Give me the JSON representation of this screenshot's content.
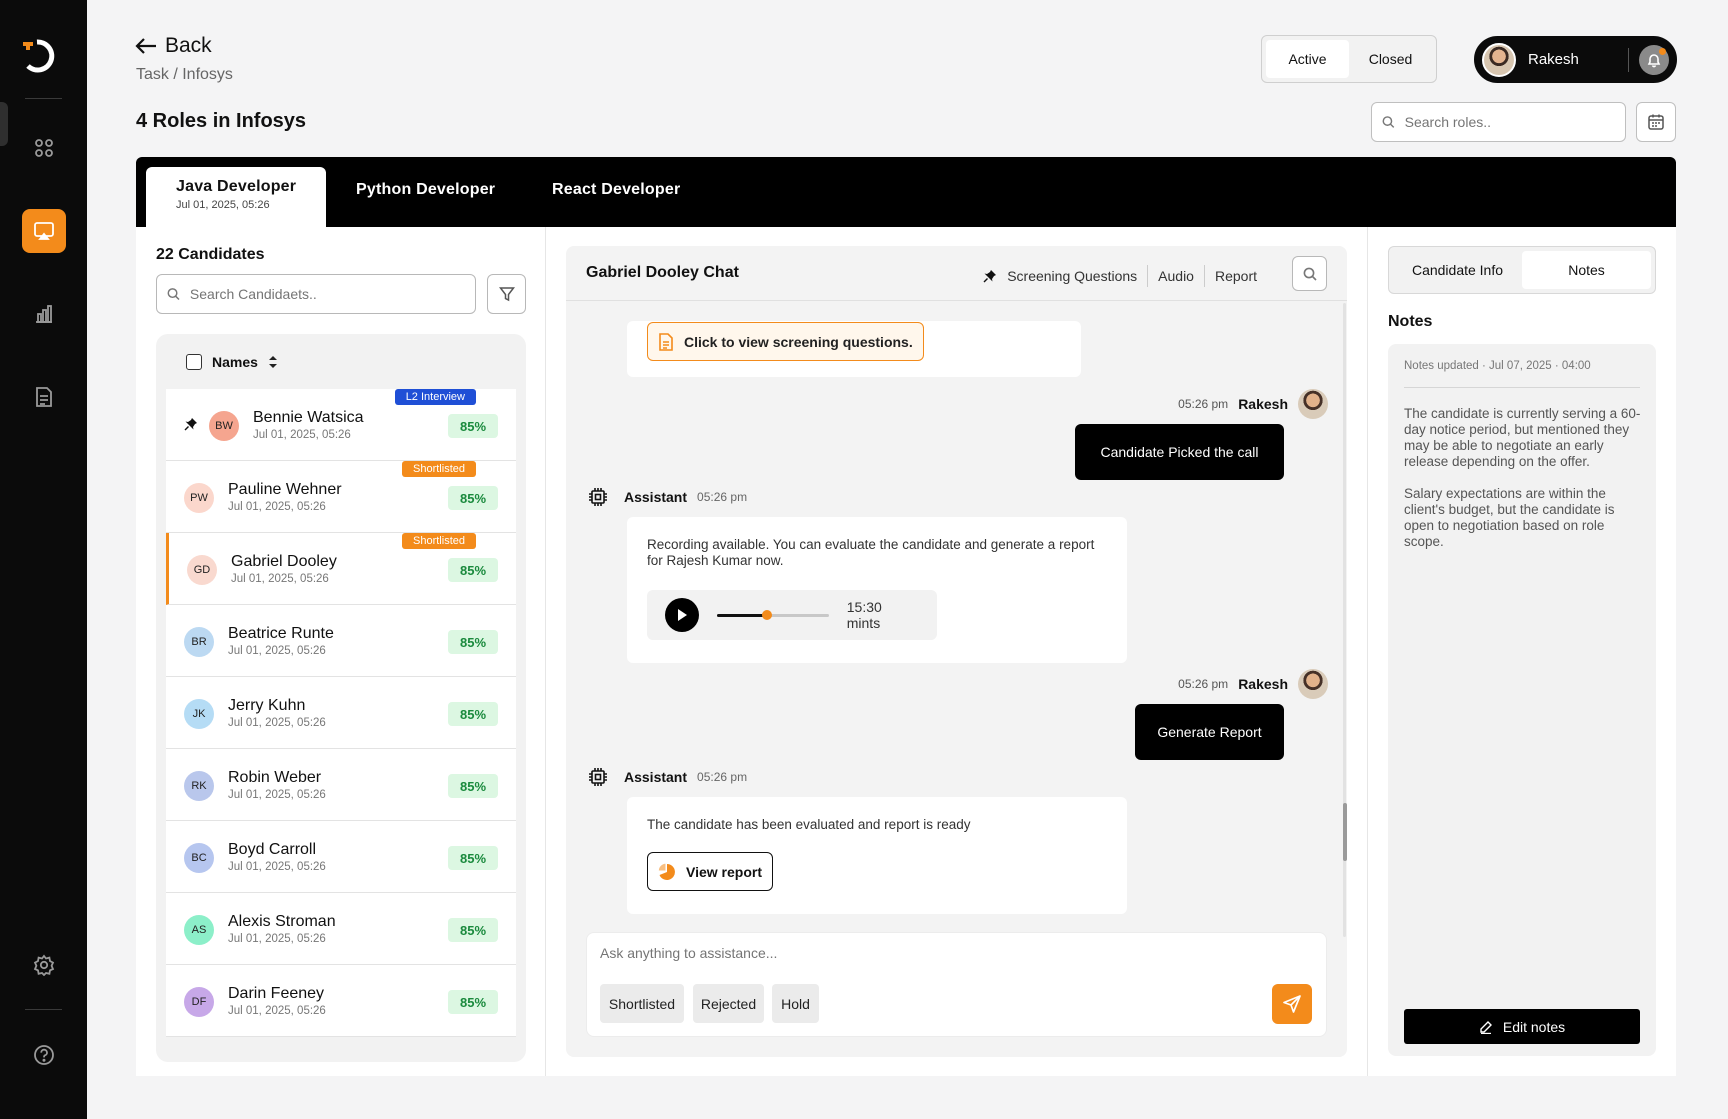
{
  "header": {
    "back_label": "Back",
    "breadcrumb": "Task / Infosys",
    "page_title": "4 Roles in Infosys",
    "status_toggle": {
      "active_label": "Active",
      "closed_label": "Closed",
      "selected": "Active"
    },
    "user": {
      "name": "Rakesh"
    },
    "search_roles_placeholder": "Search roles.."
  },
  "tabs": [
    {
      "label": "Java Developer",
      "date": "Jul 01, 2025, 05:26",
      "active": true
    },
    {
      "label": "Python Developer",
      "active": false
    },
    {
      "label": "React Developer",
      "active": false
    }
  ],
  "candidates_panel": {
    "count_label": "22 Candidates",
    "search_placeholder": "Search Candidaets..",
    "names_header": "Names",
    "candidates": [
      {
        "initials": "BW",
        "name": "Bennie Watsica",
        "date": "Jul 01, 2025, 05:26",
        "score": "85%",
        "badge": "L2 Interview",
        "pinned": true,
        "selected": false,
        "avatar_color": "#f5a58f"
      },
      {
        "initials": "PW",
        "name": "Pauline Wehner",
        "date": "Jul 01, 2025, 05:26",
        "score": "85%",
        "badge": "Shortlisted",
        "pinned": false,
        "selected": false,
        "avatar_color": "#fbd7cc"
      },
      {
        "initials": "GD",
        "name": "Gabriel Dooley",
        "date": "Jul 01, 2025, 05:26",
        "score": "85%",
        "badge": "Shortlisted",
        "pinned": false,
        "selected": true,
        "avatar_color": "#f9d9cf"
      },
      {
        "initials": "BR",
        "name": "Beatrice Runte",
        "date": "Jul 01, 2025, 05:26",
        "score": "85%",
        "badge": "",
        "pinned": false,
        "selected": false,
        "avatar_color": "#bcd9f2"
      },
      {
        "initials": "JK",
        "name": "Jerry Kuhn",
        "date": "Jul 01, 2025, 05:26",
        "score": "85%",
        "badge": "",
        "pinned": false,
        "selected": false,
        "avatar_color": "#b5dcf5"
      },
      {
        "initials": "RK",
        "name": "Robin Weber",
        "date": "Jul 01, 2025, 05:26",
        "score": "85%",
        "badge": "",
        "pinned": false,
        "selected": false,
        "avatar_color": "#b9c7ec"
      },
      {
        "initials": "BC",
        "name": "Boyd Carroll",
        "date": "Jul 01, 2025, 05:26",
        "score": "85%",
        "badge": "",
        "pinned": false,
        "selected": false,
        "avatar_color": "#b6c6ef"
      },
      {
        "initials": "AS",
        "name": "Alexis Stroman",
        "date": "Jul 01, 2025, 05:26",
        "score": "85%",
        "badge": "",
        "pinned": false,
        "selected": false,
        "avatar_color": "#8cefc9"
      },
      {
        "initials": "DF",
        "name": "Darin Feeney",
        "date": "Jul 01, 2025, 05:26",
        "score": "85%",
        "badge": "",
        "pinned": false,
        "selected": false,
        "avatar_color": "#c7a8e8"
      }
    ]
  },
  "chat": {
    "title": "Gabriel Dooley Chat",
    "links": {
      "screening": "Screening Questions",
      "audio": "Audio",
      "report": "Report"
    },
    "screening_button": "Click to view screening questions.",
    "messages": {
      "me1": {
        "time": "05:26 pm",
        "sender": "Rakesh",
        "text": "Candidate Picked the call"
      },
      "as1": {
        "sender": "Assistant",
        "time": "05:26 pm",
        "text": "Recording available. You can evaluate the candidate and generate a report for Rajesh Kumar now.",
        "audio_duration": "15:30 mints",
        "audio_progress": 0.45
      },
      "me2": {
        "time": "05:26 pm",
        "sender": "Rakesh",
        "text": "Generate Report"
      },
      "as2": {
        "sender": "Assistant",
        "time": "05:26 pm",
        "text": "The candidate has been evaluated and report is ready",
        "button": "View report"
      }
    },
    "composer": {
      "placeholder": "Ask anything to assistance...",
      "chips": [
        "Shortlisted",
        "Rejected",
        "Hold"
      ]
    }
  },
  "notes_panel": {
    "tabs": {
      "info": "Candidate Info",
      "notes": "Notes",
      "selected": "Notes"
    },
    "heading": "Notes",
    "updated": "Notes updated · Jul 07, 2025 · 04:00",
    "paragraphs": [
      "The candidate is currently serving a 60-day notice period, but mentioned they may be able to negotiate an early release depending on the offer.",
      "Salary expectations are within the client's budget, but the candidate is open to negotiation based on role scope."
    ],
    "edit_label": "Edit notes"
  },
  "colors": {
    "accent": "#f38b1b",
    "sidebar_bg": "#0b0b0b",
    "score_bg": "#dcf7e2",
    "score_text": "#1a8a3d",
    "badge_l2": "#1f4fd6",
    "badge_shortlisted": "#f38b1b"
  },
  "icons": [
    "logo-icon",
    "dashboard-icon",
    "monitor-icon",
    "bar-chart-icon",
    "document-icon",
    "gear-icon",
    "help-icon",
    "arrow-left-icon",
    "bell-icon",
    "search-icon",
    "calendar-icon",
    "filter-icon",
    "pin-icon",
    "sort-icon",
    "chip-icon",
    "file-icon",
    "play-icon",
    "pie-icon",
    "send-icon",
    "edit-icon"
  ]
}
